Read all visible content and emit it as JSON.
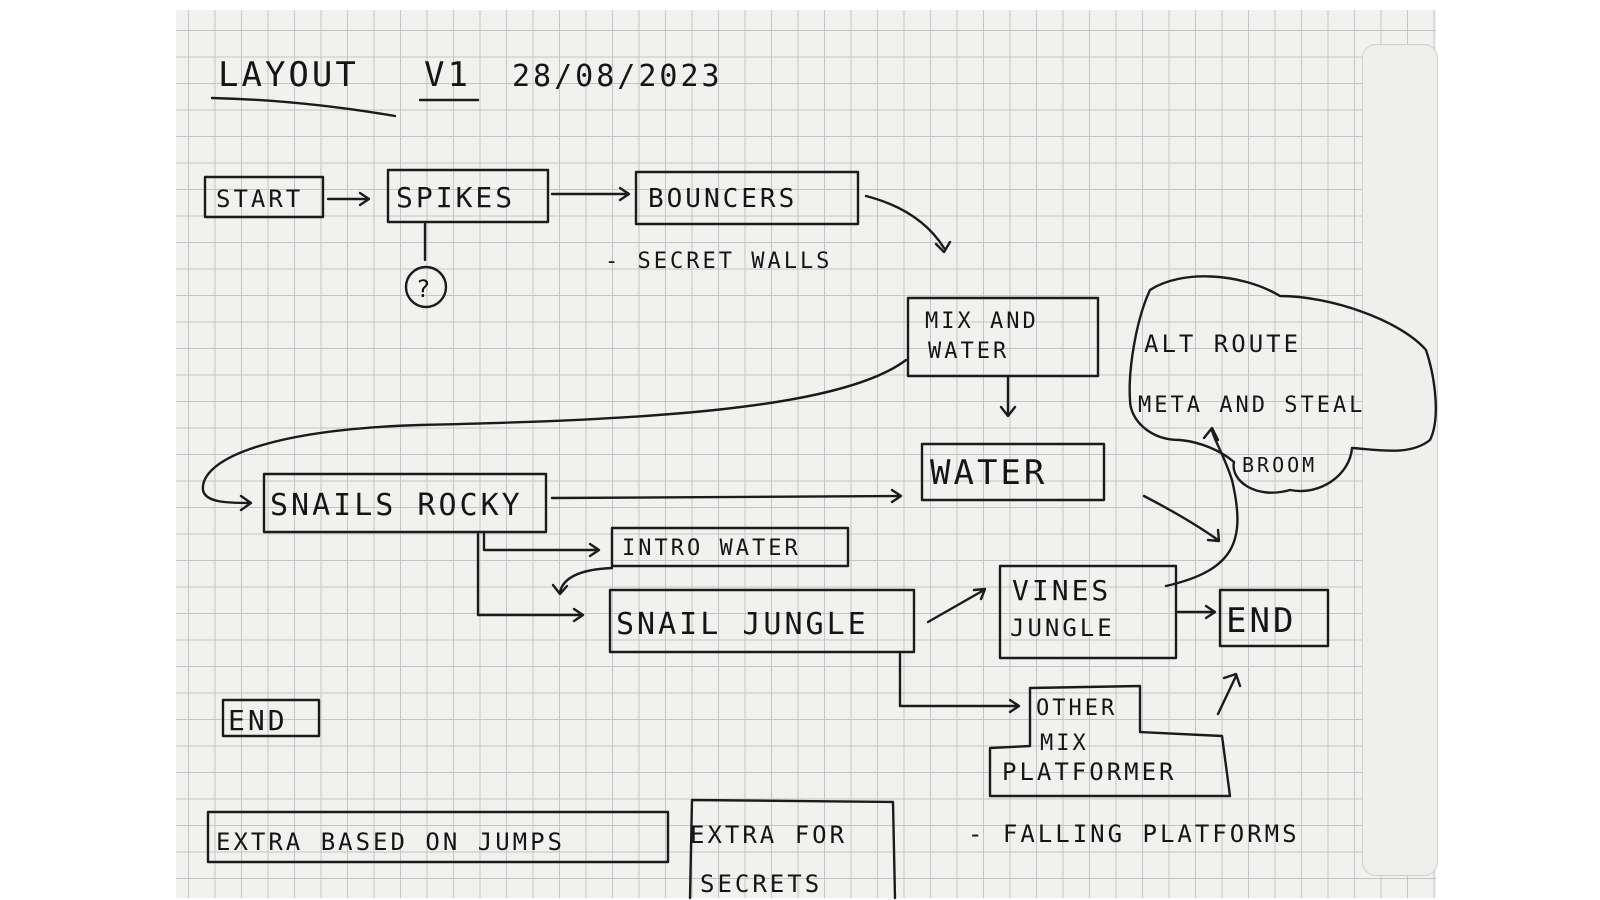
{
  "title": {
    "label": "LAYOUT",
    "version": "V1",
    "date": "28/08/2023"
  },
  "nodes": {
    "start": "START",
    "spikes": "SPIKES",
    "question": "?",
    "bouncers": "BOUNCERS",
    "secret_walls": "- SECRET WALLS",
    "mix_water_1": "MIX AND",
    "mix_water_2": "WATER",
    "water": "WATER",
    "snails_rocky": "SNAILS ROCKY",
    "intro_water": "INTRO WATER",
    "snail_jungle": "SNAIL JUNGLE",
    "vines_jungle_1": "VINES",
    "vines_jungle_2": "JUNGLE",
    "end_main": "END",
    "end_left": "END",
    "other_1": "OTHER",
    "other_2": "MIX",
    "other_3": "PLATFORMER",
    "falling": "- FALLING PLATFORMS",
    "extra_jumps": "EXTRA BASED ON JUMPS",
    "extra_secrets_1": "EXTRA FOR",
    "extra_secrets_2": "SECRETS"
  },
  "alt_route": {
    "line1": "ALT ROUTE",
    "line2": "META AND STEAL",
    "line3": "BROOM"
  },
  "colors": {
    "ink": "#1b1b1b",
    "paper": "#f1f1ef",
    "grid": "#c4c6c6"
  }
}
